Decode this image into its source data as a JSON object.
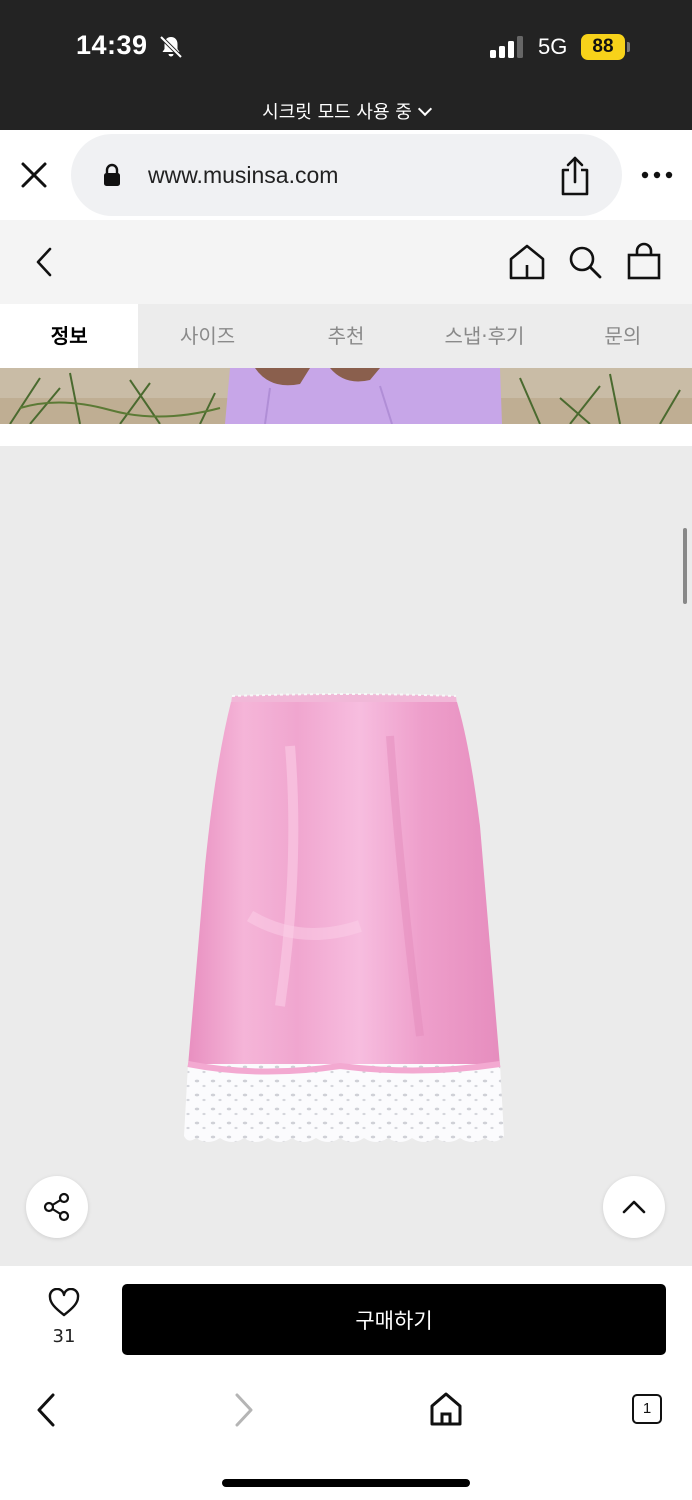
{
  "status_bar": {
    "time": "14:39",
    "network": "5G",
    "battery": "88",
    "incognito_label": "시크릿 모드 사용 중"
  },
  "browser": {
    "url": "www.musinsa.com",
    "tab_count": "1"
  },
  "tabs": [
    {
      "label": "정보",
      "active": true
    },
    {
      "label": "사이즈",
      "active": false
    },
    {
      "label": "추천",
      "active": false
    },
    {
      "label": "스냅·후기",
      "active": false
    },
    {
      "label": "문의",
      "active": false
    }
  ],
  "product": {
    "image_description": "pink satin slip skirt with white eyelet lace hem"
  },
  "buy_bar": {
    "like_count": "31",
    "buy_label": "구매하기"
  },
  "colors": {
    "status_bg": "#232323",
    "battery": "#f7d21a",
    "tab_bar": "#ececec",
    "product_bg": "#ebebeb",
    "skirt": "#f2a7cf",
    "buy_button": "#000000"
  }
}
